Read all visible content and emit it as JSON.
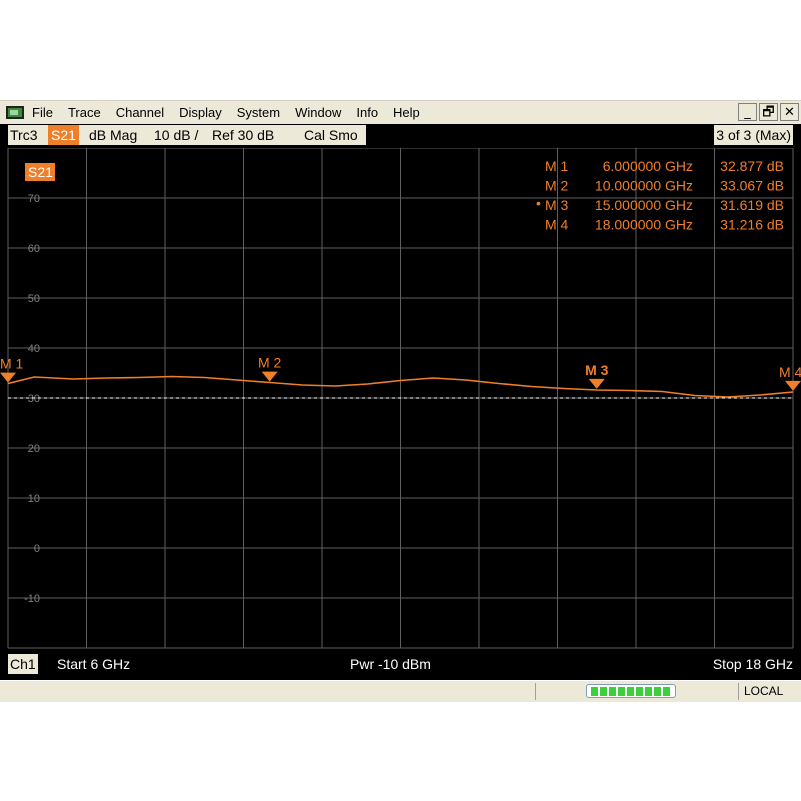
{
  "menubar": {
    "items": [
      "File",
      "Trace",
      "Channel",
      "Display",
      "System",
      "Window",
      "Info",
      "Help"
    ],
    "minimize": "_",
    "restore": "🗗",
    "close": "✕"
  },
  "tracebar": {
    "trace": "Trc3",
    "measurement": "S21",
    "format": "dB Mag",
    "scale": "10 dB /",
    "reference": "Ref 30 dB",
    "status": "Cal Smo",
    "trace_count": "3 of 3 (Max)"
  },
  "plot": {
    "badge": "S21",
    "trace_color": "#f07f2a",
    "reference_value": 30,
    "y_ticks": [
      "70",
      "60",
      "50",
      "40",
      "30",
      "20",
      "10",
      "0",
      "-10"
    ]
  },
  "markers": [
    {
      "label": "M 1",
      "freq": "6.000000 GHz",
      "value": "32.877 dB",
      "active": false
    },
    {
      "label": "M 2",
      "freq": "10.000000 GHz",
      "value": "33.067 dB",
      "active": false
    },
    {
      "label": "M 3",
      "freq": "15.000000 GHz",
      "value": "31.619 dB",
      "active": true
    },
    {
      "label": "M 4",
      "freq": "18.000000 GHz",
      "value": "31.216 dB",
      "active": false
    }
  ],
  "chart_data": {
    "type": "line",
    "title": "",
    "xlabel": "",
    "ylabel": "",
    "xlim": [
      6,
      18
    ],
    "ylim": [
      -20,
      80
    ],
    "grid": true,
    "series": [
      {
        "name": "S21",
        "x": [
          6.0,
          6.4,
          7.0,
          7.5,
          8.0,
          8.5,
          9.0,
          9.5,
          10.0,
          10.5,
          11.0,
          11.5,
          12.0,
          12.5,
          13.0,
          13.5,
          14.0,
          14.5,
          15.0,
          15.5,
          16.0,
          16.5,
          17.0,
          17.5,
          18.0
        ],
        "y": [
          32.9,
          34.2,
          33.8,
          34.0,
          34.1,
          34.3,
          34.1,
          33.6,
          33.1,
          32.6,
          32.4,
          32.8,
          33.5,
          34.0,
          33.6,
          32.9,
          32.3,
          31.9,
          31.6,
          31.5,
          31.3,
          30.5,
          30.2,
          30.6,
          31.2
        ]
      }
    ],
    "marker_x": [
      6,
      10,
      15,
      18
    ]
  },
  "channelbar": {
    "channel": "Ch1",
    "start": "Start  6 GHz",
    "power": "Pwr  -10 dBm",
    "stop": "Stop  18 GHz"
  },
  "statusbar": {
    "progress_fraction": 1,
    "mode": "LOCAL"
  }
}
